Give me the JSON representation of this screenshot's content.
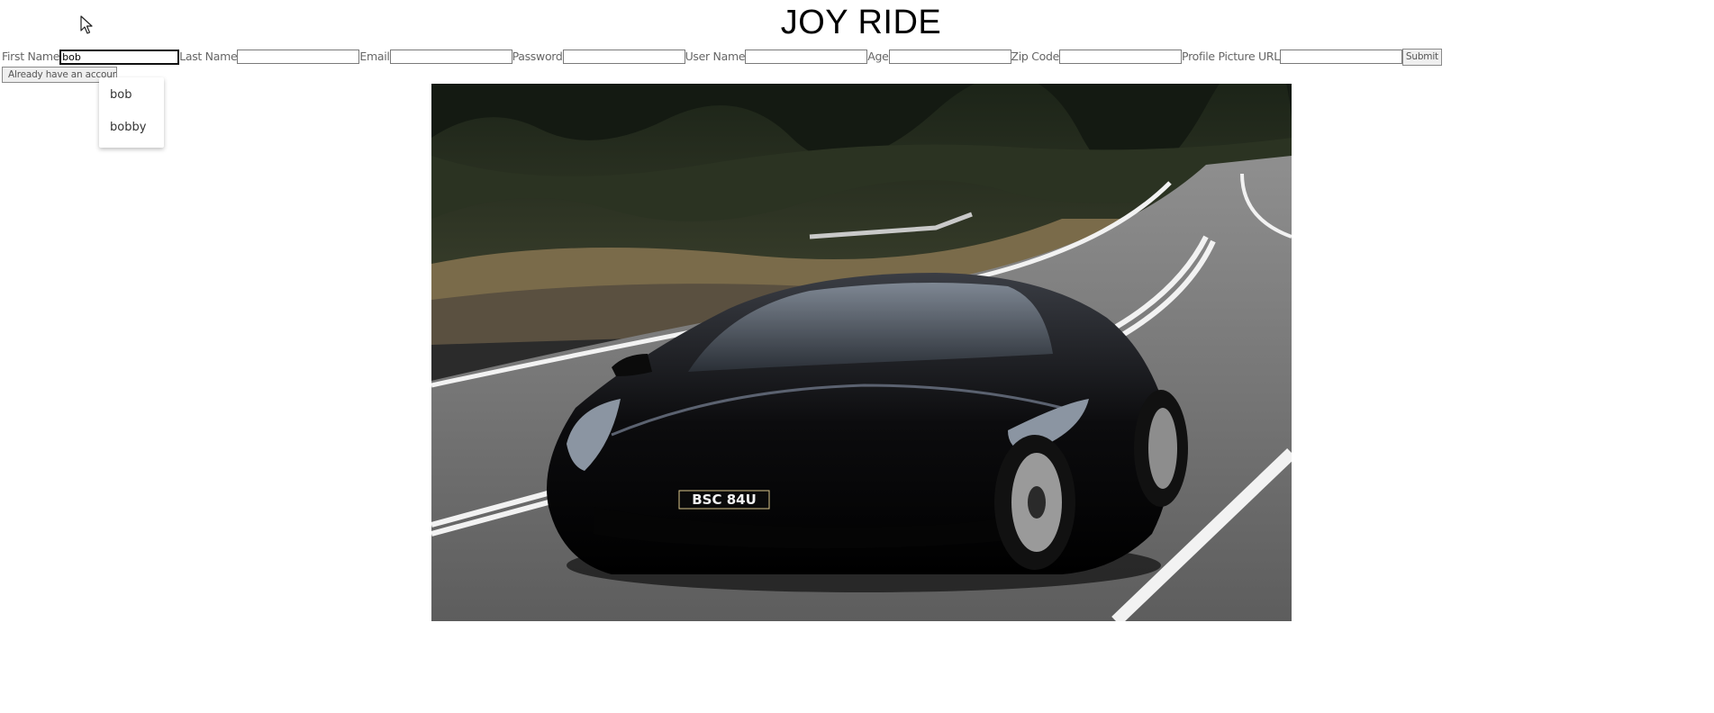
{
  "page": {
    "title": "JOY RIDE"
  },
  "form": {
    "fields": [
      {
        "label": "First Name",
        "value": "bob",
        "focused": true
      },
      {
        "label": "Last Name",
        "value": ""
      },
      {
        "label": "Email",
        "value": ""
      },
      {
        "label": "Password",
        "value": ""
      },
      {
        "label": "User Name",
        "value": ""
      },
      {
        "label": "Age",
        "value": ""
      },
      {
        "label": "Zip Code",
        "value": ""
      },
      {
        "label": "Profile Picture URL",
        "value": ""
      }
    ],
    "submit_label": "Submit",
    "account_button_label": "Already have an account?"
  },
  "autocomplete": {
    "options": [
      "bob",
      "bobby"
    ]
  },
  "hero_image": {
    "plate_text": "BSC 84U"
  },
  "cursor": {
    "icon": "arrow-cursor-icon"
  }
}
